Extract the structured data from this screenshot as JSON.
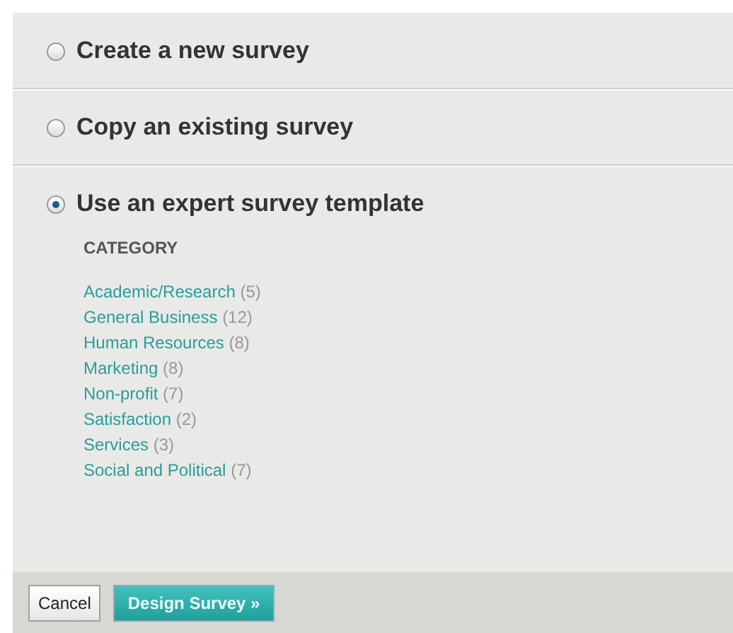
{
  "options": [
    {
      "label": "Create a new survey",
      "selected": false
    },
    {
      "label": "Copy an existing survey",
      "selected": false
    },
    {
      "label": "Use an expert survey template",
      "selected": true
    }
  ],
  "category_heading": "CATEGORY",
  "categories": [
    {
      "name": "Academic/Research",
      "count": "(5)"
    },
    {
      "name": "General Business",
      "count": "(12)"
    },
    {
      "name": "Human Resources",
      "count": "(8)"
    },
    {
      "name": "Marketing",
      "count": "(8)"
    },
    {
      "name": "Non-profit",
      "count": "(7)"
    },
    {
      "name": "Satisfaction",
      "count": "(2)"
    },
    {
      "name": "Services",
      "count": "(3)"
    },
    {
      "name": "Social and Political",
      "count": "(7)"
    }
  ],
  "buttons": [
    {
      "label": "Cancel",
      "kind": "secondary"
    },
    {
      "label": "Design Survey »",
      "kind": "primary"
    }
  ]
}
